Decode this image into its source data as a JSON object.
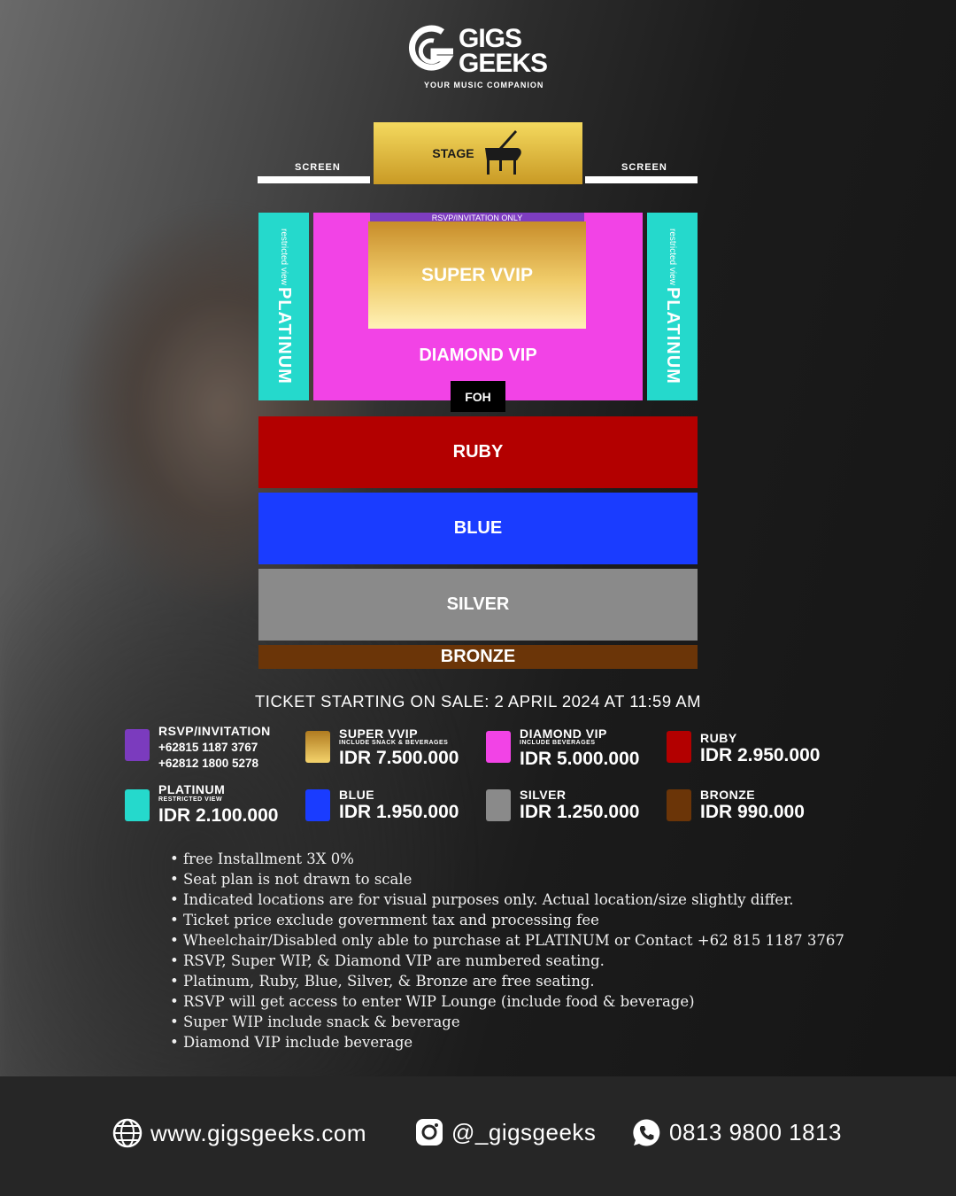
{
  "brand": {
    "name_line1": "GIGS",
    "name_line2": "GEEKS",
    "tagline": "YOUR MUSIC COMPANION",
    "icon": "gg-monogram-icon"
  },
  "map": {
    "stage_label": "STAGE",
    "stage_icon": "grand-piano-icon",
    "screen_left": "SCREEN",
    "screen_right": "SCREEN",
    "rsvp_label": "RSVP/INVITATION ONLY",
    "super_vvip": "SUPER VVIP",
    "diamond_vip": "DIAMOND VIP",
    "foh": "FOH",
    "platinum_left": "PLATINUM",
    "platinum_left_sub": "restricted view",
    "platinum_right": "PLATINUM",
    "platinum_right_sub": "restricted view",
    "ruby": "RUBY",
    "blue": "BLUE",
    "silver": "SILVER",
    "bronze": "BRONZE"
  },
  "sale_banner": "TICKET STARTING ON SALE: 2 APRIL 2024 AT 11:59 AM",
  "legend": {
    "rsvp": {
      "name": "RSVP/INVITATION",
      "phone1": "+62815 1187 3767",
      "phone2": "+62812 1800 5278",
      "color": "#7b3bbe"
    },
    "super_vvip": {
      "name": "SUPER VVIP",
      "sub": "INCLUDE SNACK & BEVERAGES",
      "price": "IDR 7.500.000",
      "color": "#e2b24a"
    },
    "diamond_vip": {
      "name": "DIAMOND VIP",
      "sub": "INCLUDE BEVERAGES",
      "price": "IDR 5.000.000",
      "color": "#f243e6"
    },
    "ruby": {
      "name": "RUBY",
      "price": "IDR 2.950.000",
      "color": "#b30000"
    },
    "platinum": {
      "name": "PLATINUM",
      "sub": "RESTRICTED VIEW",
      "price": "IDR 2.100.000",
      "color": "#25d9cc"
    },
    "blue": {
      "name": "BLUE",
      "price": "IDR 1.950.000",
      "color": "#1a3cff"
    },
    "silver": {
      "name": "SILVER",
      "price": "IDR 1.250.000",
      "color": "#8a8a8a"
    },
    "bronze": {
      "name": "BRONZE",
      "price": "IDR 990.000",
      "color": "#6b3508"
    }
  },
  "notes": [
    "• free Installment 3X 0%",
    "• Seat plan is not drawn to scale",
    "• Indicated locations are for visual purposes only. Actual location/size slightly differ.",
    "• Ticket price exclude government tax and processing fee",
    "• Wheelchair/Disabled only able to purchase at PLATINUM or Contact +62 815 1187 3767",
    "• RSVP, Super WIP, & Diamond VIP are numbered seating.",
    "• Platinum, Ruby, Blue, Silver, & Bronze are free seating.",
    "• RSVP will get access to enter WIP Lounge (include food & beverage)",
    "• Super WIP include snack & beverage",
    "• Diamond VIP include beverage"
  ],
  "footer": {
    "website": "www.gigsgeeks.com",
    "website_icon": "globe-icon",
    "instagram": "@_gigsgeeks",
    "instagram_icon": "instagram-icon",
    "phone": "0813 9800 1813",
    "phone_icon": "whatsapp-icon"
  }
}
